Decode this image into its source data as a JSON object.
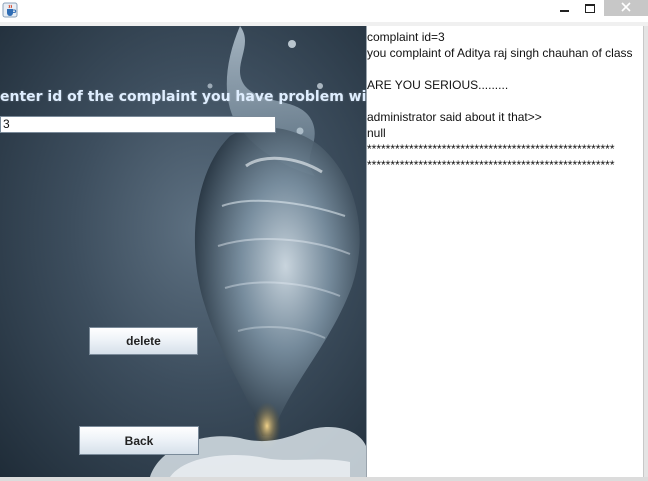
{
  "window": {
    "minimize_label": "",
    "maximize_label": "",
    "close_label": "✕"
  },
  "form": {
    "prompt_label": "enter id of the complaint you have problem with",
    "id_value": "3",
    "delete_label": "delete",
    "back_label": "Back"
  },
  "output": {
    "lines": [
      "complaint id=3",
      "you complaint of Aditya raj singh chauhan of class",
      "",
      "ARE YOU SERIOUS.........",
      "",
      "administrator said about it that>>",
      "null",
      "*****************************************************",
      "*****************************************************"
    ]
  },
  "icons": {
    "app_icon": "java-coffee-cup-icon",
    "minimize_icon": "minimize-icon",
    "maximize_icon": "maximize-icon",
    "close_icon": "close-icon"
  },
  "colors": {
    "background_dark": "#1f2c38",
    "background_mid": "#5e7182",
    "label_text": "#dfeeff",
    "close_button": "#c7c7c7"
  }
}
